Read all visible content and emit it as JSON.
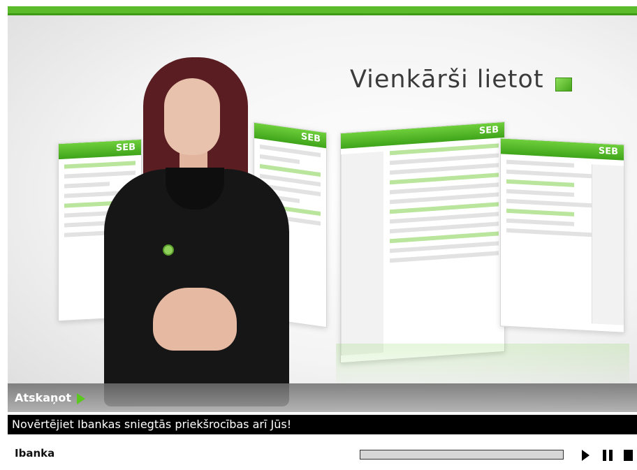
{
  "video": {
    "headline": "Vienkārši lietot",
    "card_logos": [
      "SEB",
      "SEB",
      "SEB",
      "SEB"
    ]
  },
  "play": {
    "label": "Atskaņot"
  },
  "caption": {
    "text": "Novērtējiet Ibankas sniegtās priekšrocības arī Jūs!"
  },
  "controls": {
    "title": "Ibanka",
    "progress": 0
  },
  "colors": {
    "accent_green": "#5bbb2a",
    "caption_bg": "#000000"
  },
  "icons": [
    "play-triangle-icon",
    "play-icon",
    "pause-icon",
    "stop-icon",
    "green-square-icon"
  ]
}
